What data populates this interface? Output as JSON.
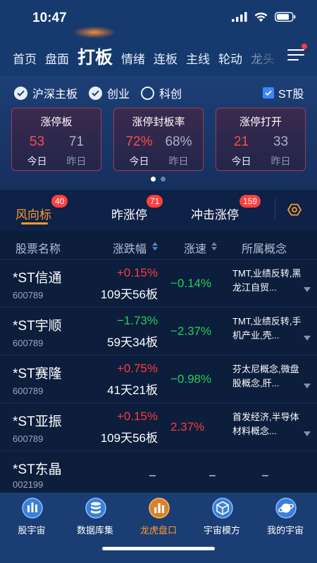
{
  "status": {
    "time": "10:47"
  },
  "nav": {
    "tabs": [
      "首页",
      "盘面",
      "打板",
      "情绪",
      "连板",
      "主线",
      "轮动",
      "龙头"
    ],
    "active": "打板"
  },
  "filters": {
    "items": [
      {
        "label": "沪深主板",
        "checked": true
      },
      {
        "label": "创业",
        "checked": true
      },
      {
        "label": "科创",
        "checked": false
      }
    ],
    "st": {
      "label": "ST股",
      "checked": true
    }
  },
  "stats": [
    {
      "title": "涨停板",
      "today": "53",
      "yesterday": "71",
      "today_label": "今日",
      "yesterday_label": "昨日"
    },
    {
      "title": "涨停封板率",
      "today": "72%",
      "yesterday": "68%",
      "today_label": "今日",
      "yesterday_label": "昨日"
    },
    {
      "title": "涨停打开",
      "today": "21",
      "yesterday": "33",
      "today_label": "今日",
      "yesterday_label": "昨日"
    }
  ],
  "subtabs": [
    {
      "label": "风向标",
      "badge": "40"
    },
    {
      "label": "昨涨停",
      "badge": "71"
    },
    {
      "label": "冲击涨停",
      "badge": "159"
    }
  ],
  "table": {
    "headers": [
      "股票名称",
      "涨跌幅",
      "涨速",
      "所属概念"
    ],
    "rows": [
      {
        "name": "*ST信通",
        "code": "600789",
        "pct": "+0.15%",
        "pct_color": "red",
        "board": "109天56板",
        "speed": "−0.14%",
        "speed_color": "green",
        "concept": "TMT,业绩反转,黑龙江自贸..."
      },
      {
        "name": "*ST宇顺",
        "code": "600789",
        "pct": "−1.73%",
        "pct_color": "green",
        "board": "59天34板",
        "speed": "−2.37%",
        "speed_color": "green",
        "concept": "TMT,业绩反转,手机产业,壳..."
      },
      {
        "name": "*ST赛隆",
        "code": "600789",
        "pct": "+0.75%",
        "pct_color": "red",
        "board": "41天21板",
        "speed": "−0.98%",
        "speed_color": "green",
        "concept": "芬太尼概念,微盘股概念,肝..."
      },
      {
        "name": "*ST亚振",
        "code": "600789",
        "pct": "+0.15%",
        "pct_color": "red",
        "board": "109天56板",
        "speed": "2.37%",
        "speed_color": "red",
        "concept": "首发经济,半导体材料概念..."
      },
      {
        "name": "*ST东晶",
        "code": "002199",
        "pct": "–",
        "board": "",
        "speed": "–",
        "concept": "–"
      }
    ]
  },
  "bottom_nav": [
    {
      "label": "股宇宙",
      "icon": "bars-icon",
      "active": false
    },
    {
      "label": "数据库集",
      "icon": "database-icon",
      "active": false
    },
    {
      "label": "龙虎盘口",
      "icon": "chart-icon",
      "active": true
    },
    {
      "label": "宇宙模方",
      "icon": "cube-icon",
      "active": false
    },
    {
      "label": "我的宇宙",
      "icon": "planet-icon",
      "active": false
    }
  ],
  "colors": {
    "up": "#ff3b3b",
    "down": "#1fcf5a",
    "accent": "#ff9a2e",
    "bg": "#0c1e3c"
  }
}
